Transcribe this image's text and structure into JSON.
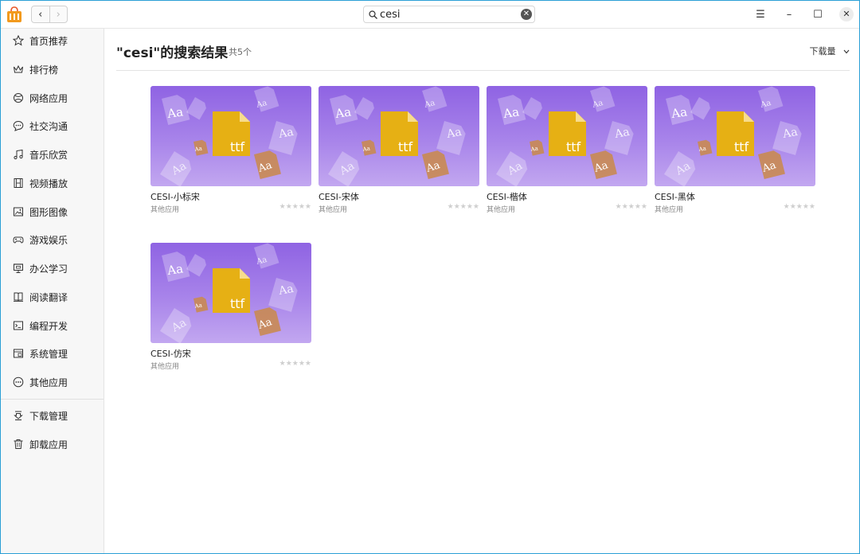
{
  "search": {
    "value": "cesi"
  },
  "nav": {
    "back": "‹",
    "forward": "›"
  },
  "window_controls": {
    "menu": "☰",
    "minimize": "–",
    "maximize": "☐",
    "close": "✕"
  },
  "sidebar": {
    "items": [
      {
        "label": "首页推荐",
        "icon": "star-icon"
      },
      {
        "label": "排行榜",
        "icon": "crown-icon"
      },
      {
        "label": "网络应用",
        "icon": "globe-icon"
      },
      {
        "label": "社交沟通",
        "icon": "chat-icon"
      },
      {
        "label": "音乐欣赏",
        "icon": "music-icon"
      },
      {
        "label": "视频播放",
        "icon": "film-icon"
      },
      {
        "label": "图形图像",
        "icon": "image-icon"
      },
      {
        "label": "游戏娱乐",
        "icon": "gamepad-icon"
      },
      {
        "label": "办公学习",
        "icon": "presentation-icon"
      },
      {
        "label": "阅读翻译",
        "icon": "book-icon"
      },
      {
        "label": "编程开发",
        "icon": "terminal-icon"
      },
      {
        "label": "系统管理",
        "icon": "system-icon"
      },
      {
        "label": "其他应用",
        "icon": "more-icon"
      }
    ],
    "bottom_items": [
      {
        "label": "下载管理",
        "icon": "download-icon"
      },
      {
        "label": "卸载应用",
        "icon": "trash-icon"
      }
    ]
  },
  "main": {
    "title": "\"cesi\"的搜索结果",
    "count": "共5个",
    "sort_label": "下载量",
    "cards": [
      {
        "name": "CESI-小标宋",
        "category": "其他应用",
        "stars": "★★★★★",
        "badge": "ttf"
      },
      {
        "name": "CESI-宋体",
        "category": "其他应用",
        "stars": "★★★★★",
        "badge": "ttf"
      },
      {
        "name": "CESI-楷体",
        "category": "其他应用",
        "stars": "★★★★★",
        "badge": "ttf"
      },
      {
        "name": "CESI-黑体",
        "category": "其他应用",
        "stars": "★★★★★",
        "badge": "ttf"
      },
      {
        "name": "CESI-仿宋",
        "category": "其他应用",
        "stars": "★★★★★",
        "badge": "ttf"
      }
    ]
  },
  "colors": {
    "accent": "#2a9fd6",
    "thumb_top": "#8f63e3",
    "thumb_bottom": "#c2a7f0",
    "file_badge": "#e6b014"
  }
}
